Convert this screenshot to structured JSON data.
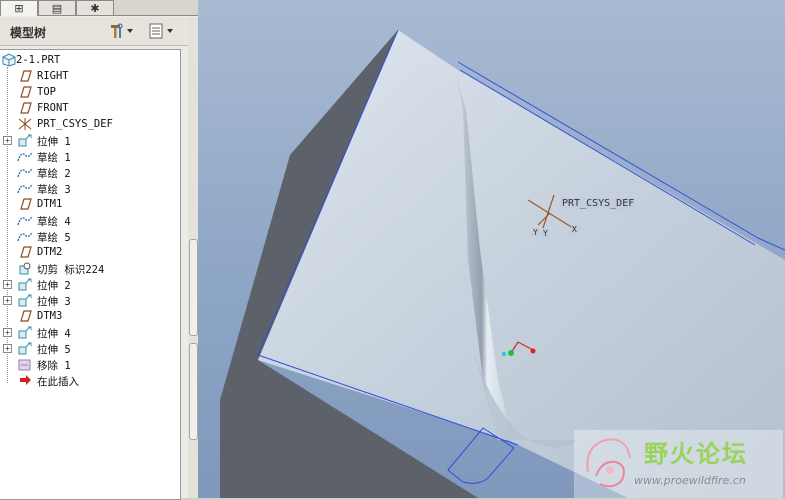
{
  "tabs": [
    {
      "name": "tree-tab",
      "glyph": "⊞"
    },
    {
      "name": "folder-tab",
      "glyph": "▤"
    },
    {
      "name": "favorites-tab",
      "glyph": "✱"
    }
  ],
  "panel": {
    "title": "模型树",
    "settings_icon": "hammer-settings-icon",
    "show_icon": "show-options-icon"
  },
  "tree": {
    "root": "2-1.PRT",
    "items": [
      {
        "label": "RIGHT",
        "icon": "datum-plane-icon",
        "expand": false
      },
      {
        "label": "TOP",
        "icon": "datum-plane-icon",
        "expand": false
      },
      {
        "label": "FRONT",
        "icon": "datum-plane-icon",
        "expand": false
      },
      {
        "label": "PRT_CSYS_DEF",
        "icon": "csys-icon",
        "expand": false
      },
      {
        "label": "拉伸 1",
        "icon": "extrude-icon",
        "expand": true
      },
      {
        "label": "草绘 1",
        "icon": "sketch-icon",
        "expand": false
      },
      {
        "label": "草绘 2",
        "icon": "sketch-icon",
        "expand": false
      },
      {
        "label": "草绘 3",
        "icon": "sketch-icon",
        "expand": false
      },
      {
        "label": "DTM1",
        "icon": "datum-plane-icon",
        "expand": false
      },
      {
        "label": "草绘 4",
        "icon": "sketch-icon",
        "expand": false
      },
      {
        "label": "草绘 5",
        "icon": "sketch-icon",
        "expand": false
      },
      {
        "label": "DTM2",
        "icon": "datum-plane-icon",
        "expand": false
      },
      {
        "label": "切剪 标识224",
        "icon": "cut-icon",
        "expand": false
      },
      {
        "label": "拉伸 2",
        "icon": "extrude-icon",
        "expand": true
      },
      {
        "label": "拉伸 3",
        "icon": "extrude-icon",
        "expand": true
      },
      {
        "label": "DTM3",
        "icon": "datum-plane-icon",
        "expand": false
      },
      {
        "label": "拉伸 4",
        "icon": "extrude-icon",
        "expand": true
      },
      {
        "label": "拉伸 5",
        "icon": "extrude-icon",
        "expand": true
      },
      {
        "label": "移除 1",
        "icon": "remove-icon",
        "expand": false
      },
      {
        "label": "在此插入",
        "icon": "insert-here-arrow-icon",
        "expand": false
      }
    ]
  },
  "viewport": {
    "csys_label": "PRT_CSYS_DEF",
    "axis_labels": [
      "Y",
      "Y",
      "X"
    ]
  },
  "watermark": {
    "title": "野火论坛",
    "url": "www.proewildfire.cn"
  },
  "colors": {
    "surface": "#c5d0dd",
    "dark_face": "#5c6068",
    "edge_highlight": "#2f4fe0",
    "background_top": "#a9bad2"
  }
}
